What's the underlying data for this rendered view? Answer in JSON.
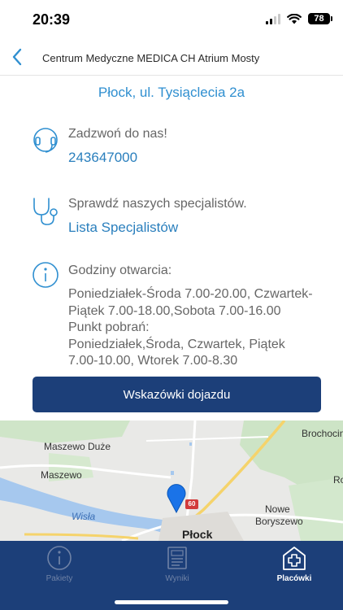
{
  "status_bar": {
    "time": "20:39",
    "battery": "78"
  },
  "nav": {
    "title": "Centrum Medyczne MEDICA CH Atrium Mosty"
  },
  "address": "Płock, ul.  Tysiąclecia 2a",
  "call": {
    "label": "Zadzwoń do nas!",
    "phone": "243647000"
  },
  "specialists": {
    "label": "Sprawdź naszych specjalistów.",
    "link": "Lista Specjalistów"
  },
  "hours": {
    "label": "Godziny otwarcia:",
    "text": "Poniedziałek-Środa 7.00-20.00, Czwartek-\nPiątek 7.00-18.00,Sobota 7.00-16.00\nPunkt  pobrań:\nPoniedziałek,Środa, Czwartek, Piątek\n7.00-10.00, Wtorek 7.00-8.30"
  },
  "directions_button": "Wskazówki dojazdu",
  "map": {
    "labels": {
      "maszewo_duze": "Maszewo Duże",
      "maszewo": "Maszewo",
      "wisla": "Wisła",
      "plock": "Płock",
      "nowe_boryszewo_1": "Nowe",
      "nowe_boryszewo_2": "Boryszewo",
      "brochocin": "Brochocin",
      "ro": "Ro"
    },
    "route_number": "60"
  },
  "tabs": [
    {
      "label": "Pakiety",
      "icon": "info-circle-icon",
      "active": false
    },
    {
      "label": "Wyniki",
      "icon": "document-icon",
      "active": false
    },
    {
      "label": "Placówki",
      "icon": "clinic-plus-icon",
      "active": true
    }
  ],
  "colors": {
    "accent": "#2f8fd0",
    "primary": "#1c3f79",
    "link": "#2a7fbd"
  }
}
